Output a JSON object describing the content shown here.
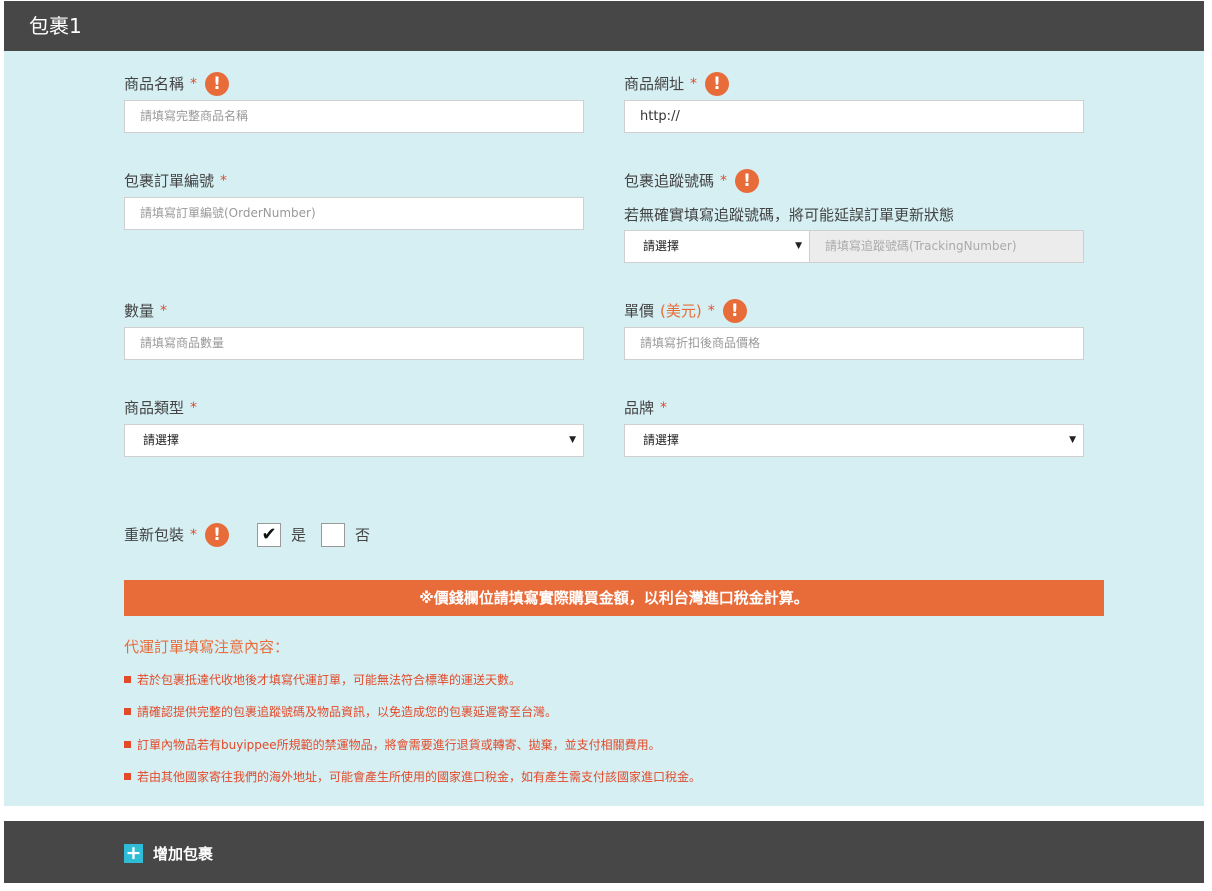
{
  "header": {
    "title": "包裹1"
  },
  "fields": {
    "product_name": {
      "label": "商品名稱",
      "required_mark": "*",
      "placeholder": "請填寫完整商品名稱"
    },
    "product_url": {
      "label": "商品網址",
      "required_mark": "*",
      "value": "http://"
    },
    "order_number": {
      "label": "包裹訂單編號",
      "required_mark": "*",
      "placeholder": "請填寫訂單編號(OrderNumber)"
    },
    "tracking": {
      "label": "包裹追蹤號碼",
      "required_mark": "*",
      "hint": "若無確實填寫追蹤號碼，將可能延誤訂單更新狀態",
      "carrier_select": "請選擇",
      "placeholder": "請填寫追蹤號碼(TrackingNumber)"
    },
    "quantity": {
      "label": "數量",
      "required_mark": "*",
      "placeholder": "請填寫商品數量"
    },
    "unit_price": {
      "label": "單價",
      "unit": "(美元)",
      "required_mark": "*",
      "placeholder": "請填寫折扣後商品價格"
    },
    "category": {
      "label": "商品類型",
      "required_mark": "*",
      "select": "請選擇"
    },
    "brand": {
      "label": "品牌",
      "required_mark": "*",
      "select": "請選擇"
    },
    "repack": {
      "label": "重新包裝",
      "required_mark": "*",
      "yes_label": "是",
      "no_label": "否",
      "yes_checked": true,
      "no_checked": false
    }
  },
  "icons": {
    "warn": "!",
    "check": "✔",
    "arrow": "▼",
    "plus": "+"
  },
  "banner": {
    "text": "※價錢欄位請填寫實際購買金額，以利台灣進口稅金計算。"
  },
  "notes": {
    "title": "代運訂單填寫注意內容：",
    "items": [
      "若於包裹抵達代收地後才填寫代運訂單，可能無法符合標準的運送天數。",
      "請確認提供完整的包裹追蹤號碼及物品資訊，以免造成您的包裹延遲寄至台灣。",
      "訂單內物品若有buyippee所規範的禁運物品，將會需要進行退貨或轉寄、拋棄，並支付相關費用。",
      "若由其他國家寄往我們的海外地址，可能會產生所使用的國家進口稅金，如有產生需支付該國家進口稅金。"
    ]
  },
  "footer": {
    "add_label": "增加包裹"
  },
  "colors": {
    "header_bg": "#474747",
    "panel_bg": "#d5eff3",
    "accent": "#e86c3a",
    "plus_icon": "#2fbcd6"
  }
}
